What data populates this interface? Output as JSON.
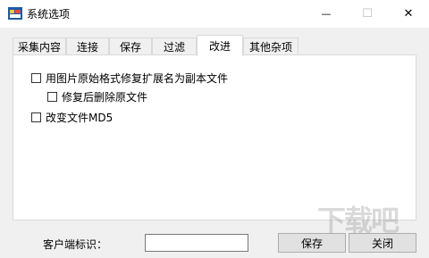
{
  "window": {
    "title": "系统选项",
    "controls": {
      "minimize": "—",
      "maximize": "☐",
      "close": "✕"
    }
  },
  "tabs": [
    {
      "label": "采集内容",
      "active": false
    },
    {
      "label": "连接",
      "active": false
    },
    {
      "label": "保存",
      "active": false
    },
    {
      "label": "过滤",
      "active": false
    },
    {
      "label": "改进",
      "active": true
    },
    {
      "label": "其他杂项",
      "active": false
    }
  ],
  "options": {
    "rename_ext": {
      "label": "用图片原始格式修复扩展名为副本文件",
      "checked": false
    },
    "delete_original": {
      "label": "修复后删除原文件",
      "checked": false
    },
    "change_md5": {
      "label": "改变文件MD5",
      "checked": false
    }
  },
  "footer": {
    "client_id_label": "客户端标识：",
    "client_id_value": "",
    "save_label": "保存",
    "close_label": "关闭"
  },
  "watermark": "下载吧",
  "colors": {
    "window_bg": "#f0f0f0",
    "panel_bg": "#ffffff",
    "border": "#d9d9d9",
    "button_bg": "#e1e1e1"
  }
}
